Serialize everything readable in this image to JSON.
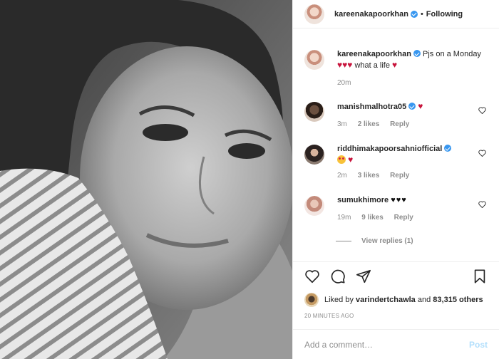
{
  "header": {
    "username": "kareenakapoorkhan",
    "separator": "•",
    "follow_status": "Following"
  },
  "comments": [
    {
      "username": "kareenakapoorkhan",
      "text": "Pjs on a Monday",
      "text_tail": "what a life",
      "time": "20m"
    },
    {
      "username": "manishmalhotra05",
      "time": "3m",
      "likes": "2 likes",
      "reply": "Reply"
    },
    {
      "username": "riddhimakapoorsahniofficial",
      "time": "2m",
      "likes": "3 likes",
      "reply": "Reply"
    },
    {
      "username": "sumukhimore",
      "emoji": "♥♥♥",
      "time": "19m",
      "likes": "9 likes",
      "reply": "Reply",
      "view_replies": "View replies (1)"
    }
  ],
  "post": {
    "liked_by_prefix": "Liked by",
    "liked_by_user": "varindertchawla",
    "liked_by_and": "and",
    "liked_by_count": "83,315 others",
    "time_ago": "20 MINUTES AGO"
  },
  "add_comment": {
    "placeholder": "Add a comment…",
    "post_label": "Post"
  },
  "colors": {
    "verified": "#3897f0",
    "link_disabled": "#b2dffc",
    "muted": "#8e8e8e",
    "heart_red": "#c8143c"
  },
  "icons": [
    "heart-icon",
    "comment-icon",
    "share-icon",
    "bookmark-icon",
    "verified-icon"
  ]
}
